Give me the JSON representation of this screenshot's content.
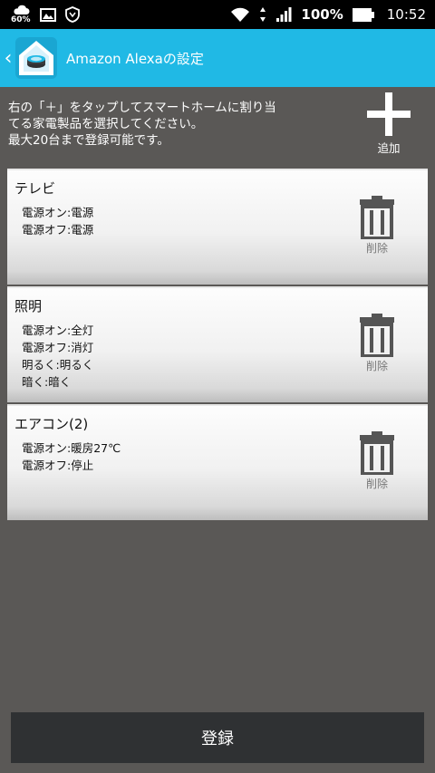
{
  "status_bar": {
    "temperature": "60%",
    "battery_percent": "100%",
    "time": "10:52",
    "icons": [
      "weather-cloud-icon",
      "image-icon",
      "shield-icon",
      "wifi-icon",
      "data-arrows-icon",
      "signal-icon",
      "battery-icon"
    ]
  },
  "app_bar": {
    "back_icon": "chevron-left-icon",
    "app_icon": "smart-home-icon",
    "title": "Amazon Alexaの設定",
    "color": "#20b9e5"
  },
  "instructions": {
    "lines": [
      "右の「＋」をタップしてスマートホームに割り当",
      "てる家電製品を選択してください。",
      "最大20台まで登録可能です。"
    ]
  },
  "add_button": {
    "icon": "plus-icon",
    "label": "追加"
  },
  "devices": [
    {
      "name": "テレビ",
      "commands": [
        "電源オン:電源",
        "電源オフ:電源"
      ],
      "delete_label": "削除",
      "delete_icon": "trash-icon"
    },
    {
      "name": "照明",
      "commands": [
        "電源オン:全灯",
        "電源オフ:消灯",
        "明るく:明るく",
        "暗く:暗く"
      ],
      "delete_label": "削除",
      "delete_icon": "trash-icon"
    },
    {
      "name": "エアコン(2)",
      "commands": [
        "電源オン:暖房27℃",
        "電源オフ:停止"
      ],
      "delete_label": "削除",
      "delete_icon": "trash-icon"
    }
  ],
  "register_button": {
    "label": "登録"
  }
}
